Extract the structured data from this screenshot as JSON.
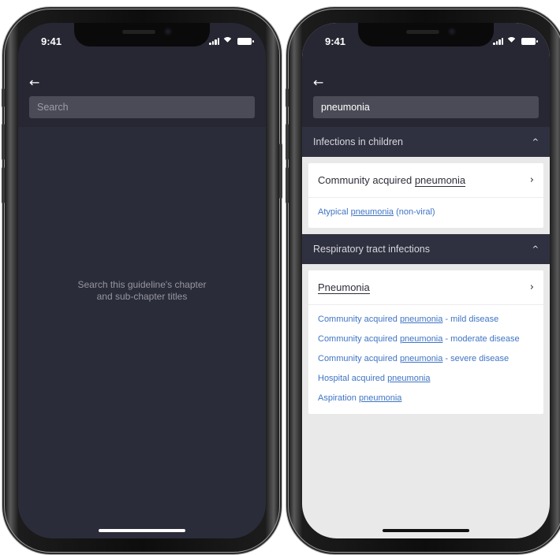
{
  "status_bar": {
    "time": "9:41"
  },
  "left_screen": {
    "search": {
      "placeholder": "Search",
      "value": ""
    },
    "empty_hint": {
      "line1": "Search this guideline's chapter",
      "line2": "and sub-chapter titles"
    }
  },
  "right_screen": {
    "search": {
      "placeholder": "Search",
      "value": "pneumonia"
    },
    "sections": [
      {
        "title": "Infections in children",
        "main": {
          "prefix": "Community acquired ",
          "highlight": "pneumonia",
          "suffix": ""
        },
        "subs": [
          {
            "prefix": "Atypical ",
            "highlight": "pneumonia",
            "suffix": " (non-viral)"
          }
        ]
      },
      {
        "title": "Respiratory tract infections",
        "main": {
          "prefix": "",
          "highlight": "Pneumonia",
          "suffix": ""
        },
        "subs": [
          {
            "prefix": "Community acquired ",
            "highlight": "pneumonia",
            "suffix": " - mild disease"
          },
          {
            "prefix": "Community acquired ",
            "highlight": "pneumonia",
            "suffix": " - moderate disease"
          },
          {
            "prefix": "Community acquired ",
            "highlight": "pneumonia",
            "suffix": " - severe disease"
          },
          {
            "prefix": "Hospital acquired ",
            "highlight": "pneumonia",
            "suffix": ""
          },
          {
            "prefix": "Aspiration ",
            "highlight": "pneumonia",
            "suffix": ""
          }
        ]
      }
    ]
  },
  "icons": {
    "back": "←",
    "collapse": "^",
    "chevron_right": "›"
  },
  "colors": {
    "dark_bg": "#2b2c39",
    "header_bg": "#303140",
    "link": "#3f74c4",
    "light_bg": "#e9e9ea"
  }
}
